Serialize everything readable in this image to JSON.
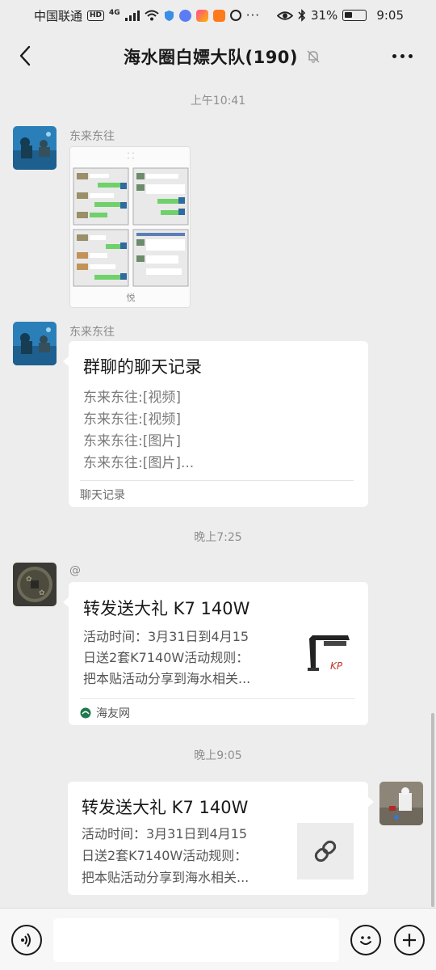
{
  "status_bar": {
    "carrier": "中国联通",
    "hd": "HD",
    "network": "4G",
    "battery": "31%",
    "time": "9:05"
  },
  "nav": {
    "title": "海水圈白嫖大队(190)",
    "muted_icon": "bell-slash-icon",
    "more_icon": "more-icon"
  },
  "messages": [
    {
      "time": "上午10:41"
    },
    {
      "sender": "东来东往",
      "type": "image",
      "thumb_caption": "悦"
    },
    {
      "sender": "东来东往",
      "type": "chat_record",
      "title": "群聊的聊天记录",
      "lines": [
        "东来东往:[视频]",
        "东来东往:[视频]",
        "东来东往:[图片]",
        "东来东往:[图片]..."
      ],
      "footer": "聊天记录"
    },
    {
      "time": "晚上7:25"
    },
    {
      "sender": "@",
      "type": "link_card",
      "title": "转发送大礼 K7 140W",
      "lines": [
        "活动时间：3月31日到4月15",
        "日送2套K7140W活动规则：",
        "把本贴活动分享到海水相关..."
      ],
      "source": "海友网",
      "thumb_brand": "KP"
    },
    {
      "time": "晚上9:05"
    },
    {
      "sender": "me",
      "type": "link_card",
      "title": "转发送大礼 K7 140W",
      "lines": [
        "活动时间：3月31日到4月15",
        "日送2套K7140W活动规则：",
        "把本贴活动分享到海水相关..."
      ],
      "thumb_icon": "link-icon"
    }
  ],
  "input_bar": {
    "voice_icon": "voice-icon",
    "emoji_icon": "emoji-icon",
    "plus_icon": "plus-icon",
    "placeholder": ""
  },
  "colors": {
    "background": "#ededed",
    "bubble": "#ffffff",
    "muted_text": "#8e8e8e",
    "link_thumb_bg": "#ececec"
  }
}
